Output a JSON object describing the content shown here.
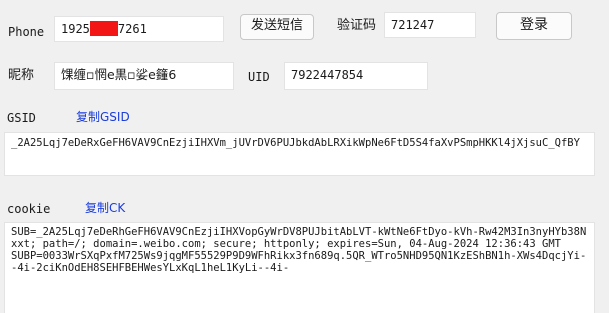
{
  "phone": {
    "label": "Phone",
    "value_prefix": "1925",
    "value_suffix": "7261",
    "send_sms_button": "发送短信"
  },
  "verify": {
    "label": "验证码",
    "value": "721247",
    "login_button": "登录"
  },
  "nickname": {
    "label": "昵称",
    "value": "馃缠▫惘e黒▫娑e籦6"
  },
  "uid": {
    "label": "UID",
    "value": "7922447854"
  },
  "gsid": {
    "label": "GSID",
    "copy_link": "复制GSID",
    "value": "_2A25Lqj7eDeRxGeFH6VAV9CnEzjiIHXVm_jUVrDV6PUJbkdAbLRXikWpNe6FtD5S4faXvPSmpHKKl4jXjsuC_QfBY"
  },
  "cookie": {
    "label": "cookie",
    "copy_link": "复制CK",
    "value": "SUB=_2A25Lqj7eDeRhGeFH6VAV9CnEzjiIHXVopGyWrDV8PUJbitAbLVT-kWtNe6FtDyo-kVh-Rw42M3In3nyHYb38Nxxt; path=/; domain=.weibo.com; secure; httponly; expires=Sun, 04-Aug-2024 12:36:43 GMT\nSUBP=0033WrSXqPxfM725Ws9jqgMF55529P9D9WFhRikx3fn689q.5QR_WTro5NHD95QN1KzEShBN1h-XWs4DqcjYi--4i-2ciKnOdEH8SEHFBEHWesYLxKqL1heL1KyLi--4i-\n"
  },
  "colors": {
    "background": "#f0f0f0",
    "link": "#1a3cdc",
    "redaction": "#f21616"
  }
}
